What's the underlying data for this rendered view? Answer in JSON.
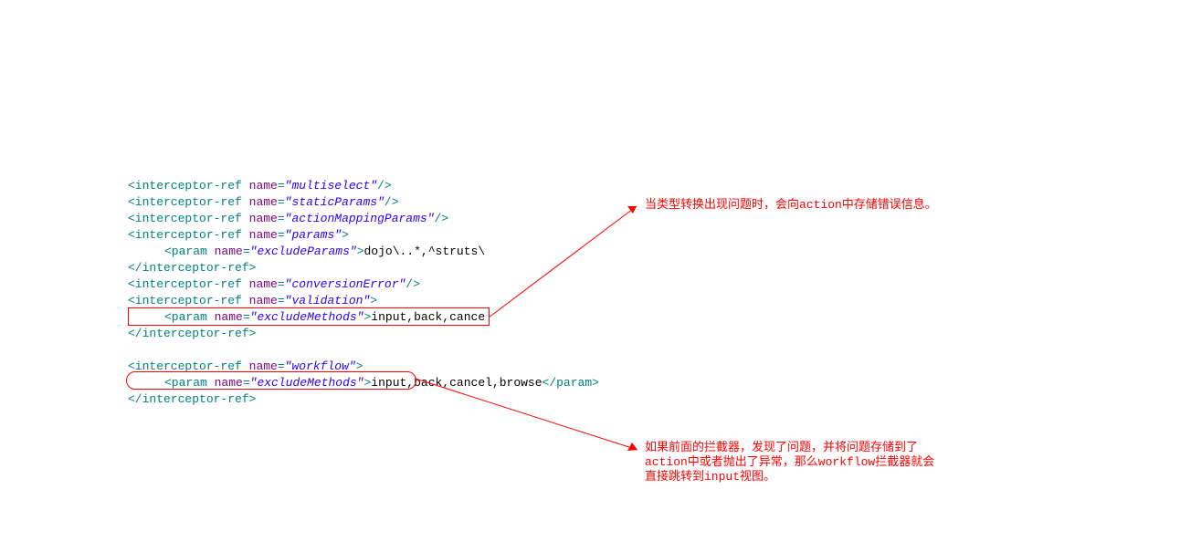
{
  "code": {
    "lines": [
      {
        "parts": [
          {
            "t": "tag",
            "v": "<interceptor-ref"
          },
          {
            "t": "sp",
            "v": " "
          },
          {
            "t": "attr-name",
            "v": "name"
          },
          {
            "t": "tag",
            "v": "="
          },
          {
            "t": "attr-value",
            "v": "\"multiselect\""
          },
          {
            "t": "tag",
            "v": "/>"
          }
        ],
        "indent": 0
      },
      {
        "parts": [
          {
            "t": "tag",
            "v": "<interceptor-ref"
          },
          {
            "t": "sp",
            "v": " "
          },
          {
            "t": "attr-name",
            "v": "name"
          },
          {
            "t": "tag",
            "v": "="
          },
          {
            "t": "attr-value",
            "v": "\"staticParams\""
          },
          {
            "t": "tag",
            "v": "/>"
          }
        ],
        "indent": 0
      },
      {
        "parts": [
          {
            "t": "tag",
            "v": "<interceptor-ref"
          },
          {
            "t": "sp",
            "v": " "
          },
          {
            "t": "attr-name",
            "v": "name"
          },
          {
            "t": "tag",
            "v": "="
          },
          {
            "t": "attr-value",
            "v": "\"actionMappingParams\""
          },
          {
            "t": "tag",
            "v": "/>"
          }
        ],
        "indent": 0
      },
      {
        "parts": [
          {
            "t": "tag",
            "v": "<interceptor-ref"
          },
          {
            "t": "sp",
            "v": " "
          },
          {
            "t": "attr-name",
            "v": "name"
          },
          {
            "t": "tag",
            "v": "="
          },
          {
            "t": "attr-value",
            "v": "\"params\""
          },
          {
            "t": "tag",
            "v": ">"
          }
        ],
        "indent": 0
      },
      {
        "parts": [
          {
            "t": "tag",
            "v": "<param"
          },
          {
            "t": "sp",
            "v": " "
          },
          {
            "t": "attr-name",
            "v": "name"
          },
          {
            "t": "tag",
            "v": "="
          },
          {
            "t": "attr-value",
            "v": "\"excludeParams\""
          },
          {
            "t": "tag",
            "v": ">"
          },
          {
            "t": "text-content",
            "v": "dojo\\..*,^struts\\"
          }
        ],
        "indent": 1
      },
      {
        "parts": [
          {
            "t": "tag",
            "v": "</interceptor-ref>"
          }
        ],
        "indent": 0
      },
      {
        "parts": [
          {
            "t": "tag",
            "v": "<interceptor-ref"
          },
          {
            "t": "sp",
            "v": " "
          },
          {
            "t": "attr-name",
            "v": "name"
          },
          {
            "t": "tag",
            "v": "="
          },
          {
            "t": "attr-value",
            "v": "\"conversionError\""
          },
          {
            "t": "tag",
            "v": "/>"
          }
        ],
        "indent": 0
      },
      {
        "parts": [
          {
            "t": "tag",
            "v": "<interceptor-ref"
          },
          {
            "t": "sp",
            "v": " "
          },
          {
            "t": "attr-name",
            "v": "name"
          },
          {
            "t": "tag",
            "v": "="
          },
          {
            "t": "attr-value",
            "v": "\"validation\""
          },
          {
            "t": "tag",
            "v": ">"
          }
        ],
        "indent": 0
      },
      {
        "parts": [
          {
            "t": "tag",
            "v": "<param"
          },
          {
            "t": "sp",
            "v": " "
          },
          {
            "t": "attr-name",
            "v": "name"
          },
          {
            "t": "tag",
            "v": "="
          },
          {
            "t": "attr-value",
            "v": "\"excludeMethods\""
          },
          {
            "t": "tag",
            "v": ">"
          },
          {
            "t": "text-content",
            "v": "input,back,cance"
          }
        ],
        "indent": 1
      },
      {
        "parts": [
          {
            "t": "tag",
            "v": "</interceptor-ref>"
          }
        ],
        "indent": 0
      }
    ],
    "blank": "",
    "lines2": [
      {
        "parts": [
          {
            "t": "tag",
            "v": "<interceptor-ref"
          },
          {
            "t": "sp",
            "v": " "
          },
          {
            "t": "attr-name",
            "v": "name"
          },
          {
            "t": "tag",
            "v": "="
          },
          {
            "t": "attr-value",
            "v": "\"workflow\""
          },
          {
            "t": "tag",
            "v": ">"
          }
        ],
        "indent": 0
      },
      {
        "parts": [
          {
            "t": "tag",
            "v": "<param"
          },
          {
            "t": "sp",
            "v": " "
          },
          {
            "t": "attr-name",
            "v": "name"
          },
          {
            "t": "tag",
            "v": "="
          },
          {
            "t": "attr-value",
            "v": "\"excludeMethods\""
          },
          {
            "t": "tag",
            "v": ">"
          },
          {
            "t": "text-content",
            "v": "input,back,cancel,browse"
          },
          {
            "t": "tag",
            "v": "</param>"
          }
        ],
        "indent": 1
      },
      {
        "parts": [
          {
            "t": "tag",
            "v": "</interceptor-ref>"
          }
        ],
        "indent": 0
      }
    ]
  },
  "annotations": {
    "a1": "当类型转换出现问题时，会向action中存储错误信息。",
    "a2_l1": "如果前面的拦截器，发现了问题，并将问题存储到了",
    "a2_l2": "action中或者抛出了异常，那么workflow拦截器就会",
    "a2_l3": "直接跳转到input视图。"
  }
}
